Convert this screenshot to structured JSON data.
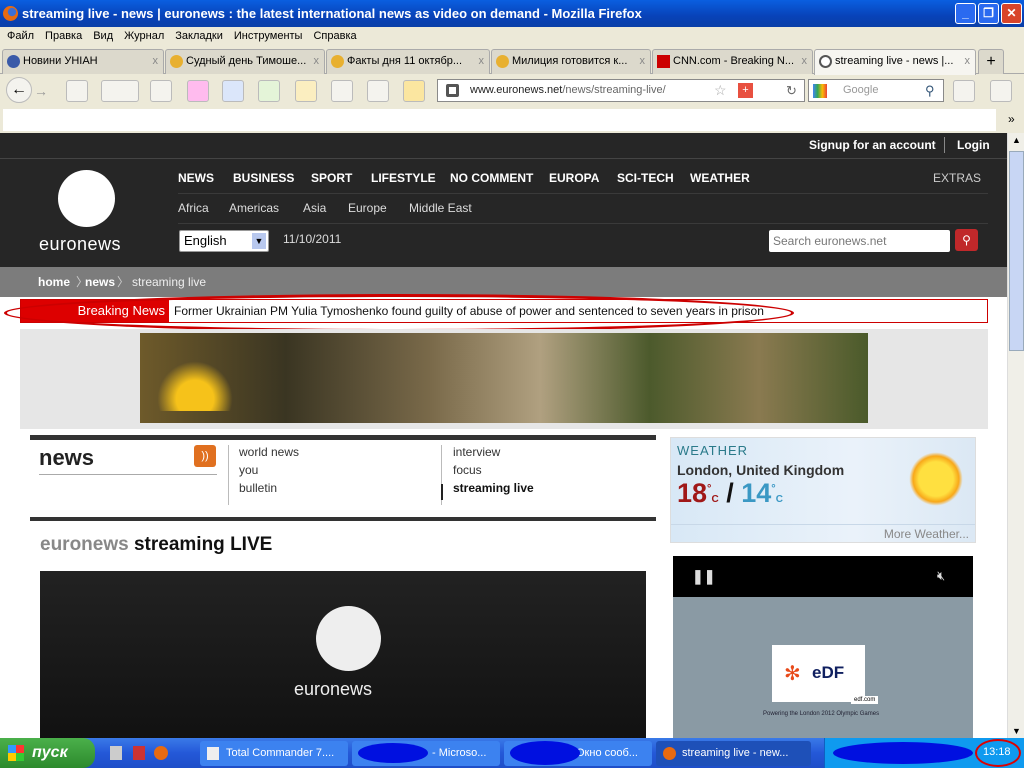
{
  "window": {
    "title": "streaming live - news | euronews : the latest international news as video on demand - Mozilla Firefox"
  },
  "menu": [
    "Файл",
    "Правка",
    "Вид",
    "Журнал",
    "Закладки",
    "Инструменты",
    "Справка"
  ],
  "tabs": [
    {
      "label": "Новини УНІАН"
    },
    {
      "label": "Судный день Тимоше..."
    },
    {
      "label": "Факты дня 11 октябр..."
    },
    {
      "label": "Милиция готовится к..."
    },
    {
      "label": "CNN.com - Breaking N..."
    },
    {
      "label": "streaming live - news |..."
    }
  ],
  "url": {
    "domain": "www.euronews.net",
    "path": "/news/streaming-live/"
  },
  "search_engine": {
    "placeholder": "Google"
  },
  "site": {
    "signup": "Signup for an account",
    "login": "Login",
    "logo": "euronews",
    "nav": [
      "NEWS",
      "BUSINESS",
      "SPORT",
      "LIFESTYLE",
      "NO COMMENT",
      "EUROPA",
      "SCI-TECH",
      "WEATHER"
    ],
    "extras": "EXTRAS",
    "regions": [
      "Africa",
      "Americas",
      "Asia",
      "Europe",
      "Middle East"
    ],
    "language": "English",
    "date": "11/10/2011",
    "search_placeholder": "Search euronews.net",
    "breadcrumb": [
      "home",
      "news",
      "streaming live"
    ],
    "breaking_label": "Breaking News",
    "breaking_text": "Former Ukrainian PM Yulia Tymoshenko found guilty of abuse of power and sentenced to seven years in prison",
    "section": "news",
    "sublinks_col1": [
      "world news",
      "you",
      "bulletin"
    ],
    "sublinks_col2": [
      "interview",
      "focus",
      "streaming live"
    ],
    "page_title_brand": "euronews",
    "page_title": "streaming LIVE",
    "weather": {
      "heading": "WEATHER",
      "city": "London, United Kingdom",
      "high": "18",
      "low": "14",
      "unit": "C",
      "more": "More Weather..."
    },
    "ad": {
      "brand": "eDF",
      "url": "edf.com",
      "tagline": "Powering the London 2012 Olympic Games"
    }
  },
  "taskbar": {
    "start": "пуск",
    "tasks": [
      "Total Commander 7....",
      "- Microso...",
      "Окно сооб...",
      "streaming live - new..."
    ],
    "clock": "13:18"
  }
}
